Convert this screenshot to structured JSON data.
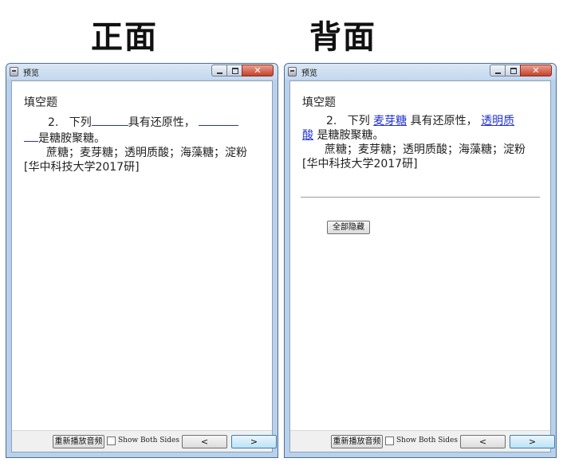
{
  "headings": {
    "front": "正面",
    "back": "背面"
  },
  "windows": {
    "front": {
      "title": "预览",
      "question_type": "填空题",
      "number": "2.",
      "stem_before": "下列",
      "stem_mid": "具有还原性，",
      "stem_after": "是糖胺聚糖。",
      "choices_text": "蔗糖；麦芽糖；透明质酸；海藻糖；淀粉[华中科技大学2017研]",
      "footer": {
        "replay_label": "重新播放音频",
        "show_both_label": "Show Both Sides",
        "show_both_checked": false,
        "prev_label": "<",
        "next_label": ">"
      }
    },
    "back": {
      "title": "预览",
      "question_type": "填空题",
      "number": "2.",
      "stem_before": "下列",
      "answer1": "麦芽糖",
      "stem_mid": "具有还原性，",
      "answer2": "透明质酸",
      "stem_after": "是糖胺聚糖。",
      "choices_text": "蔗糖；麦芽糖；透明质酸；海藻糖；淀粉[华中科技大学2017研]",
      "hide_all_label": "全部隐藏",
      "footer": {
        "replay_label": "重新播放音频",
        "show_both_label": "Show Both Sides",
        "show_both_checked": false,
        "prev_label": "<",
        "next_label": ">"
      }
    }
  },
  "colors": {
    "answer_blue": "#2233cc",
    "window_frame": "#b9d1ea",
    "close_red": "#c5402b"
  }
}
